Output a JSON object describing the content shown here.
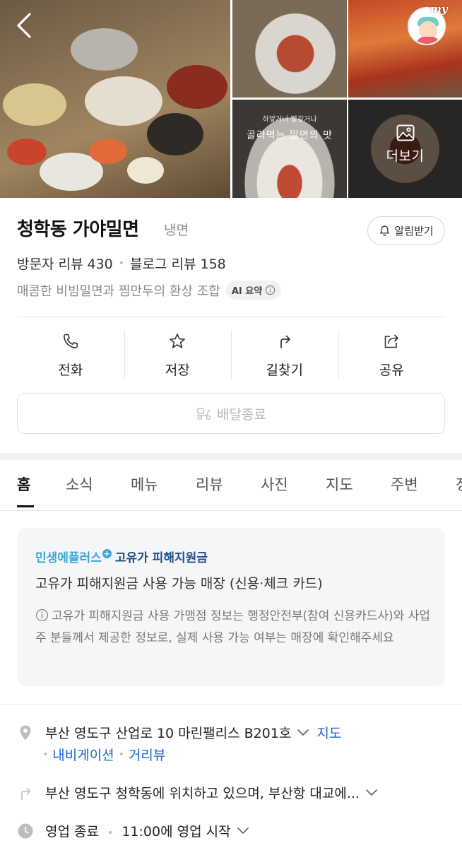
{
  "gallery": {
    "caption_small": "하얗거나 빨갛거나",
    "caption_big": "골라먹는 밀면의 맛",
    "more_label": "더보기",
    "profile_badge": "my"
  },
  "place": {
    "name": "청학동 가야밀면",
    "category": "냉면",
    "notify_label": "알림받기",
    "visitor_reviews": "방문자 리뷰 430",
    "blog_reviews": "블로그 리뷰 158",
    "summary": "매콤한 비빔밀면과 찜만두의 환상 조합",
    "ai_label": "AI 요약"
  },
  "actions": [
    {
      "label": "전화",
      "icon": "phone-icon"
    },
    {
      "label": "저장",
      "icon": "star-icon"
    },
    {
      "label": "길찾기",
      "icon": "directions-icon"
    },
    {
      "label": "공유",
      "icon": "share-icon"
    }
  ],
  "delivery": {
    "label": "배달종료",
    "icon": "delivery-scooter-icon"
  },
  "tabs": [
    "홈",
    "소식",
    "메뉴",
    "리뷰",
    "사진",
    "지도",
    "주변",
    "정"
  ],
  "active_tab": "홈",
  "benefit_card": {
    "brand": "민생에플러스",
    "program": "고유가 피해지원금",
    "title": "고유가 피해지원금 사용 가능 매장 (신용·체크 카드)",
    "note": "고유가 피해지원금 사용 가맹점 정보는 행정안전부(참여 신용카드사)와 사업주 분들께서 제공한 정보로, 실제 사용 가능 여부는 매장에 확인해주세요"
  },
  "details": {
    "address": "부산 영도구 산업로 10 마린팰리스 B201호",
    "map_link": "지도",
    "navigation_link": "내비게이션",
    "street_view_link": "거리뷰",
    "directions": "부산 영도구 청학동에 위치하고 있으며, 부산항 대교에...",
    "hours_status": "영업 종료",
    "hours_text": "11:00에 영업 시작"
  },
  "colors": {
    "link": "#1a66d6",
    "brand_accent": "#3aa6d8",
    "program_accent": "#1f4d88",
    "muted": "#8a8a8a"
  }
}
